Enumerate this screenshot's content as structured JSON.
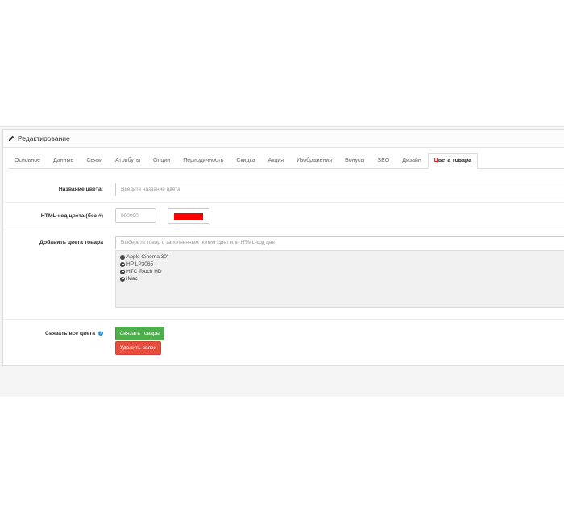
{
  "panel": {
    "title": "Редактирование"
  },
  "tabs": [
    {
      "label": "Основное"
    },
    {
      "label": "Данные"
    },
    {
      "label": "Связи"
    },
    {
      "label": "Атрибуты"
    },
    {
      "label": "Опции"
    },
    {
      "label": "Периодичность"
    },
    {
      "label": "Скидка"
    },
    {
      "label": "Акция"
    },
    {
      "label": "Изображения"
    },
    {
      "label": "Бонусы"
    },
    {
      "label": "SEO"
    },
    {
      "label": "Дизайн"
    }
  ],
  "active_tab": {
    "label_red": "Ц",
    "label_rest": "вета товара"
  },
  "form": {
    "color_name": {
      "label": "Название цвета:",
      "placeholder": "Введите название цвета"
    },
    "html_code": {
      "label": "HTML-код цвета (без #)",
      "placeholder": "000000",
      "swatch_color": "#ff0000"
    },
    "add_colors": {
      "label": "Добавить цвета товара",
      "placeholder": "Выберите товар с заполненным полем Цвет или HTML-код цвет",
      "products": [
        {
          "name": "Apple Cinema 30\""
        },
        {
          "name": "HP LP3065"
        },
        {
          "name": "HTC Touch HD"
        },
        {
          "name": "iMac"
        }
      ]
    },
    "link_all": {
      "label": "Связать все цвета",
      "link_button": "Связать товары",
      "unlink_button": "Удалить связи"
    }
  },
  "colors": {
    "green": "#4cae4c",
    "red": "#e74c3c",
    "info": "#1e91cf"
  }
}
